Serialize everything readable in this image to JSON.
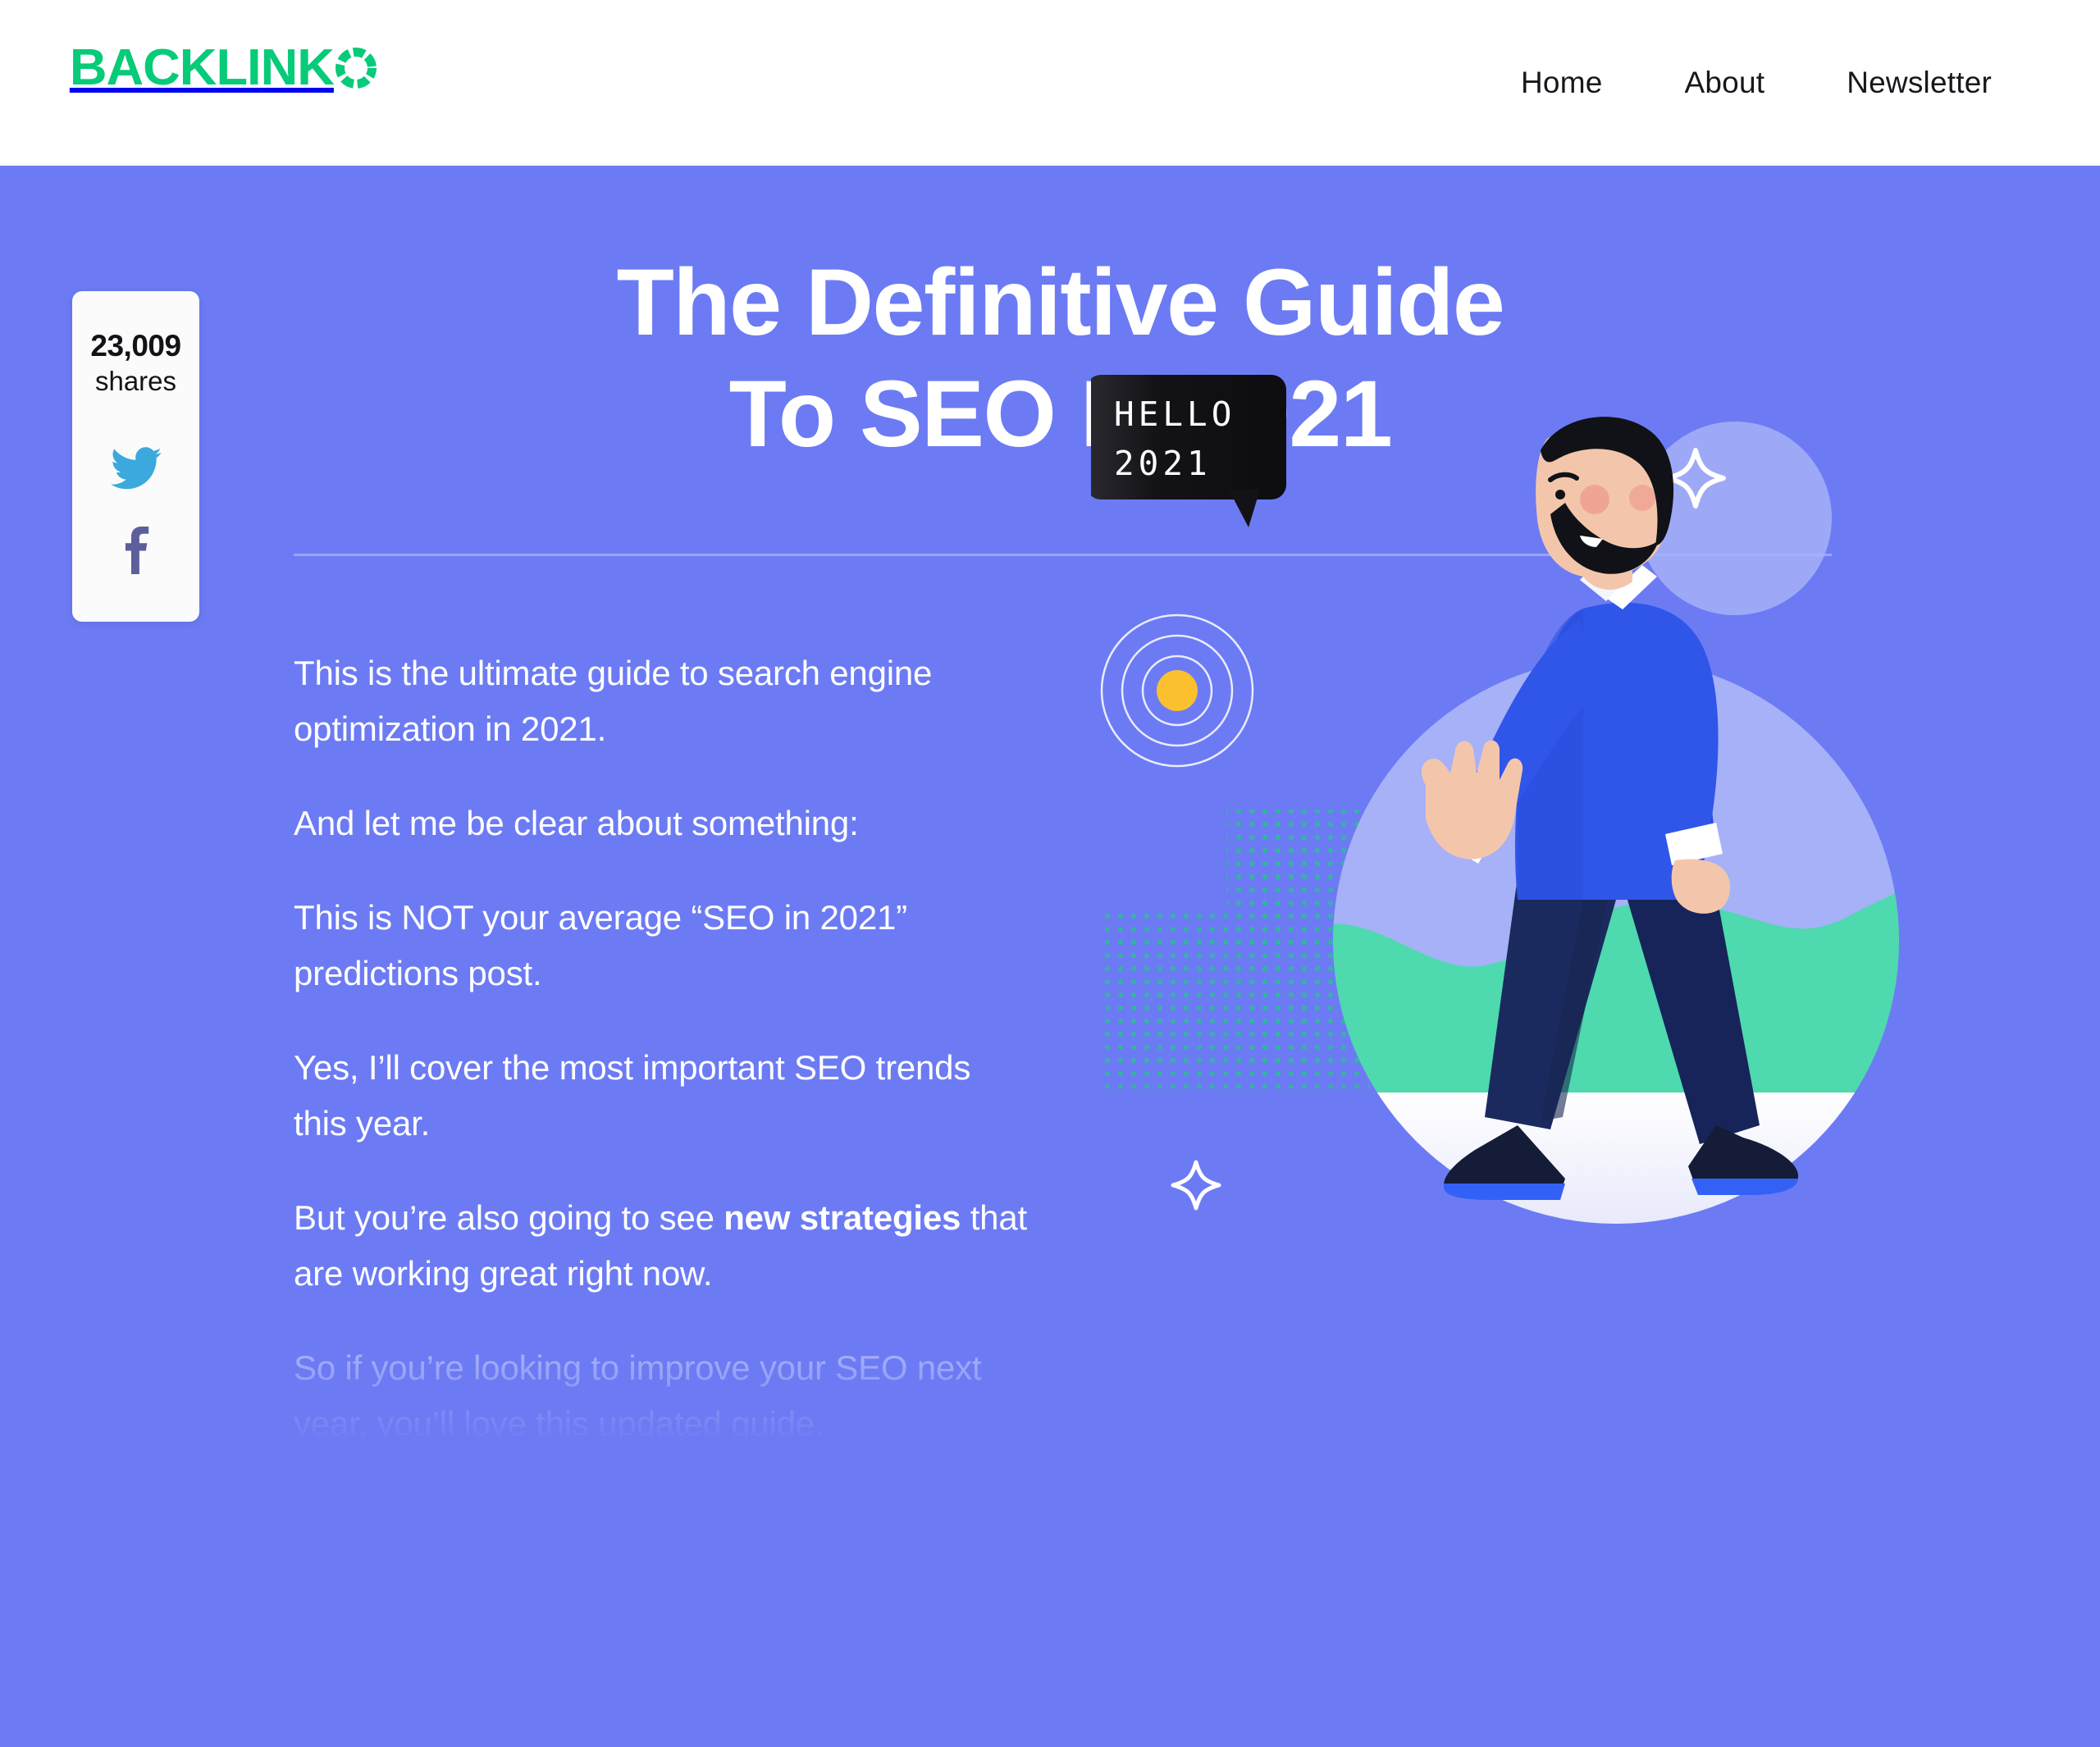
{
  "header": {
    "logo_text": "BACKLINK",
    "logo_o_icon": "segmented-ring-icon",
    "logo_color": "#07CB79",
    "nav": [
      {
        "label": "Home"
      },
      {
        "label": "About"
      },
      {
        "label": "Newsletter"
      }
    ]
  },
  "hero": {
    "background_color": "#6C7BF4",
    "title": "The Definitive Guide To SEO In 2021",
    "title_line_1": "The Definitive Guide",
    "title_line_2": "To SEO In 2021",
    "share": {
      "count": "23,009",
      "label": "shares",
      "twitter_icon": "twitter-bird-icon",
      "twitter_color": "#3BA9DD",
      "facebook_icon": "facebook-f-icon",
      "facebook_color": "#5D5E9C"
    },
    "paragraphs": [
      {
        "text": "This is the ultimate guide to search engine optimization in 2021.",
        "faded": false
      },
      {
        "text": "And let me be clear about something:",
        "faded": false
      },
      {
        "text": "This is NOT your average “SEO in 2021” predictions post.",
        "faded": false
      },
      {
        "text": "Yes, I’ll cover the most important SEO trends this year.",
        "faded": false
      },
      {
        "text": "But you’re also going to see new strategies that are working great right now.",
        "faded": false,
        "bold_segment": "new strategies",
        "prefix": "But you’re also going to see ",
        "suffix": " that are working great right now."
      },
      {
        "text": "So if you’re looking to improve your SEO next year, you’ll love this updated guide.",
        "faded": true
      }
    ],
    "illustration": {
      "name": "walking-man-illustration",
      "speech_bubble_line_1": "HELLO",
      "speech_bubble_line_2": "2021",
      "bubble_color": "#131317",
      "sweater_color": "#2F56E8",
      "pants_color": "#1B2A5E",
      "accent_green": "#4ED9AE",
      "accent_yellow": "#FBC02D"
    }
  }
}
